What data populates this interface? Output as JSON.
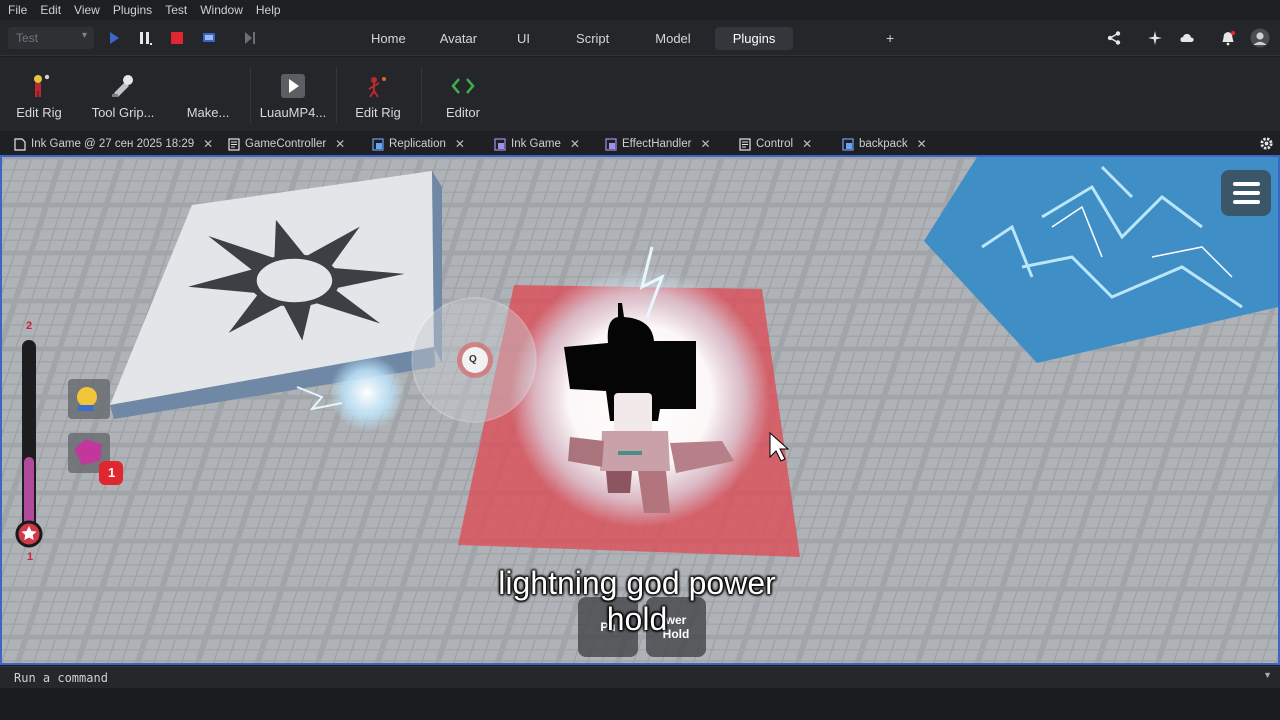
{
  "menu": [
    "File",
    "Edit",
    "View",
    "Plugins",
    "Test",
    "Window",
    "Help"
  ],
  "toolbar": {
    "mode_select": "Test",
    "tabs": [
      {
        "label": "Home",
        "active": false
      },
      {
        "label": "Avatar",
        "active": false
      },
      {
        "label": "UI",
        "active": false
      },
      {
        "label": "Script",
        "active": false
      },
      {
        "label": "Model",
        "active": false
      },
      {
        "label": "Plugins",
        "active": true
      }
    ],
    "plus": "+"
  },
  "ribbon": {
    "items": [
      {
        "label": "Edit Rig",
        "icon": "rig-figure-icon"
      },
      {
        "label": "Tool Grip...",
        "icon": "tool-grip-icon"
      },
      {
        "label": "Make...",
        "icon": "make-icon"
      },
      {
        "label": "LuauMP4...",
        "icon": "play-video-icon"
      },
      {
        "label": "Edit Rig",
        "icon": "rig-edit-icon"
      },
      {
        "label": "Editor",
        "icon": "code-editor-icon"
      }
    ]
  },
  "doc_tabs": [
    {
      "label": "Ink Game @ 27 сен 2025 18:29",
      "icon": "place-file-icon",
      "color": "#e6e6e6"
    },
    {
      "label": "GameController",
      "icon": "script-icon",
      "color": "#e6e6e6"
    },
    {
      "label": "Replication",
      "icon": "module-script-icon",
      "color": "#6aa3f0"
    },
    {
      "label": "Ink Game",
      "icon": "local-script-icon",
      "color": "#a58ee8"
    },
    {
      "label": "EffectHandler",
      "icon": "local-script-icon",
      "color": "#a58ee8"
    },
    {
      "label": "Control",
      "icon": "script-icon",
      "color": "#e6e6e6"
    },
    {
      "label": "backpack",
      "icon": "module-script-icon",
      "color": "#6aa3f0"
    }
  ],
  "viewport": {
    "caption_line1": "lightning god power",
    "caption_line2": "hold",
    "buttons": [
      "Pu",
      "wer\nHold"
    ],
    "q_key": "Q",
    "meter_top": "2",
    "meter_bottom": "1",
    "badge_count": "1"
  },
  "command_bar": {
    "placeholder": "Run a command"
  },
  "colors": {
    "accent": "#3a66c8",
    "stop": "#e0262e",
    "pad_red": "#d9535e",
    "water": "#3f8ec6"
  }
}
